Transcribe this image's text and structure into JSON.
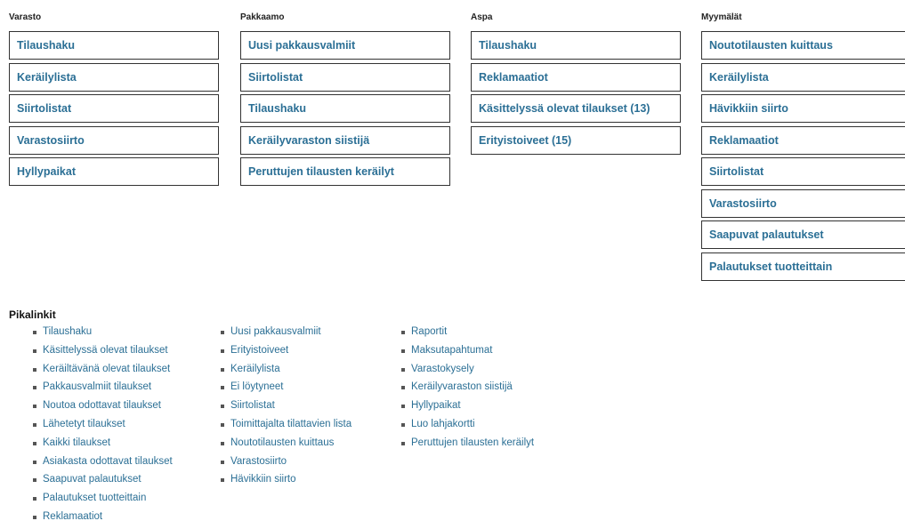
{
  "columns": [
    {
      "title": "Varasto",
      "buttons": [
        "Tilaushaku",
        "Keräilylista",
        "Siirtolistat",
        "Varastosiirto",
        "Hyllypaikat"
      ]
    },
    {
      "title": "Pakkaamo",
      "buttons": [
        "Uusi pakkausvalmiit",
        "Siirtolistat",
        "Tilaushaku",
        "Keräilyvaraston siistijä",
        "Peruttujen tilausten keräilyt"
      ]
    },
    {
      "title": "Aspa",
      "buttons": [
        "Tilaushaku",
        "Reklamaatiot",
        "Käsittelyssä olevat tilaukset (13)",
        "Erityistoiveet (15)"
      ]
    },
    {
      "title": "Myymälät",
      "buttons": [
        "Noutotilausten kuittaus",
        "Keräilylista",
        "Hävikkiin siirto",
        "Reklamaatiot",
        "Siirtolistat",
        "Varastosiirto",
        "Saapuvat palautukset",
        "Palautukset tuotteittain"
      ]
    }
  ],
  "pikalinkit": {
    "title": "Pikalinkit",
    "lists": [
      [
        "Tilaushaku",
        "Käsittelyssä olevat tilaukset",
        "Keräiltävänä olevat tilaukset",
        "Pakkausvalmiit tilaukset",
        "Noutoa odottavat tilaukset",
        "Lähetetyt tilaukset",
        "Kaikki tilaukset",
        "Asiakasta odottavat tilaukset",
        "Saapuvat palautukset",
        "Palautukset tuotteittain",
        "Reklamaatiot"
      ],
      [
        "Uusi pakkausvalmiit",
        "Erityistoiveet",
        "Keräilylista",
        "Ei löytyneet",
        "Siirtolistat",
        "Toimittajalta tilattavien lista",
        "Noutotilausten kuittaus",
        "Varastosiirto",
        "Hävikkiin siirto"
      ],
      [
        "Raportit",
        "Maksutapahtumat",
        "Varastokysely",
        "Keräilyvaraston siistijä",
        "Hyllypaikat",
        "Luo lahjakortti",
        "Peruttujen tilausten keräilyt"
      ]
    ]
  }
}
